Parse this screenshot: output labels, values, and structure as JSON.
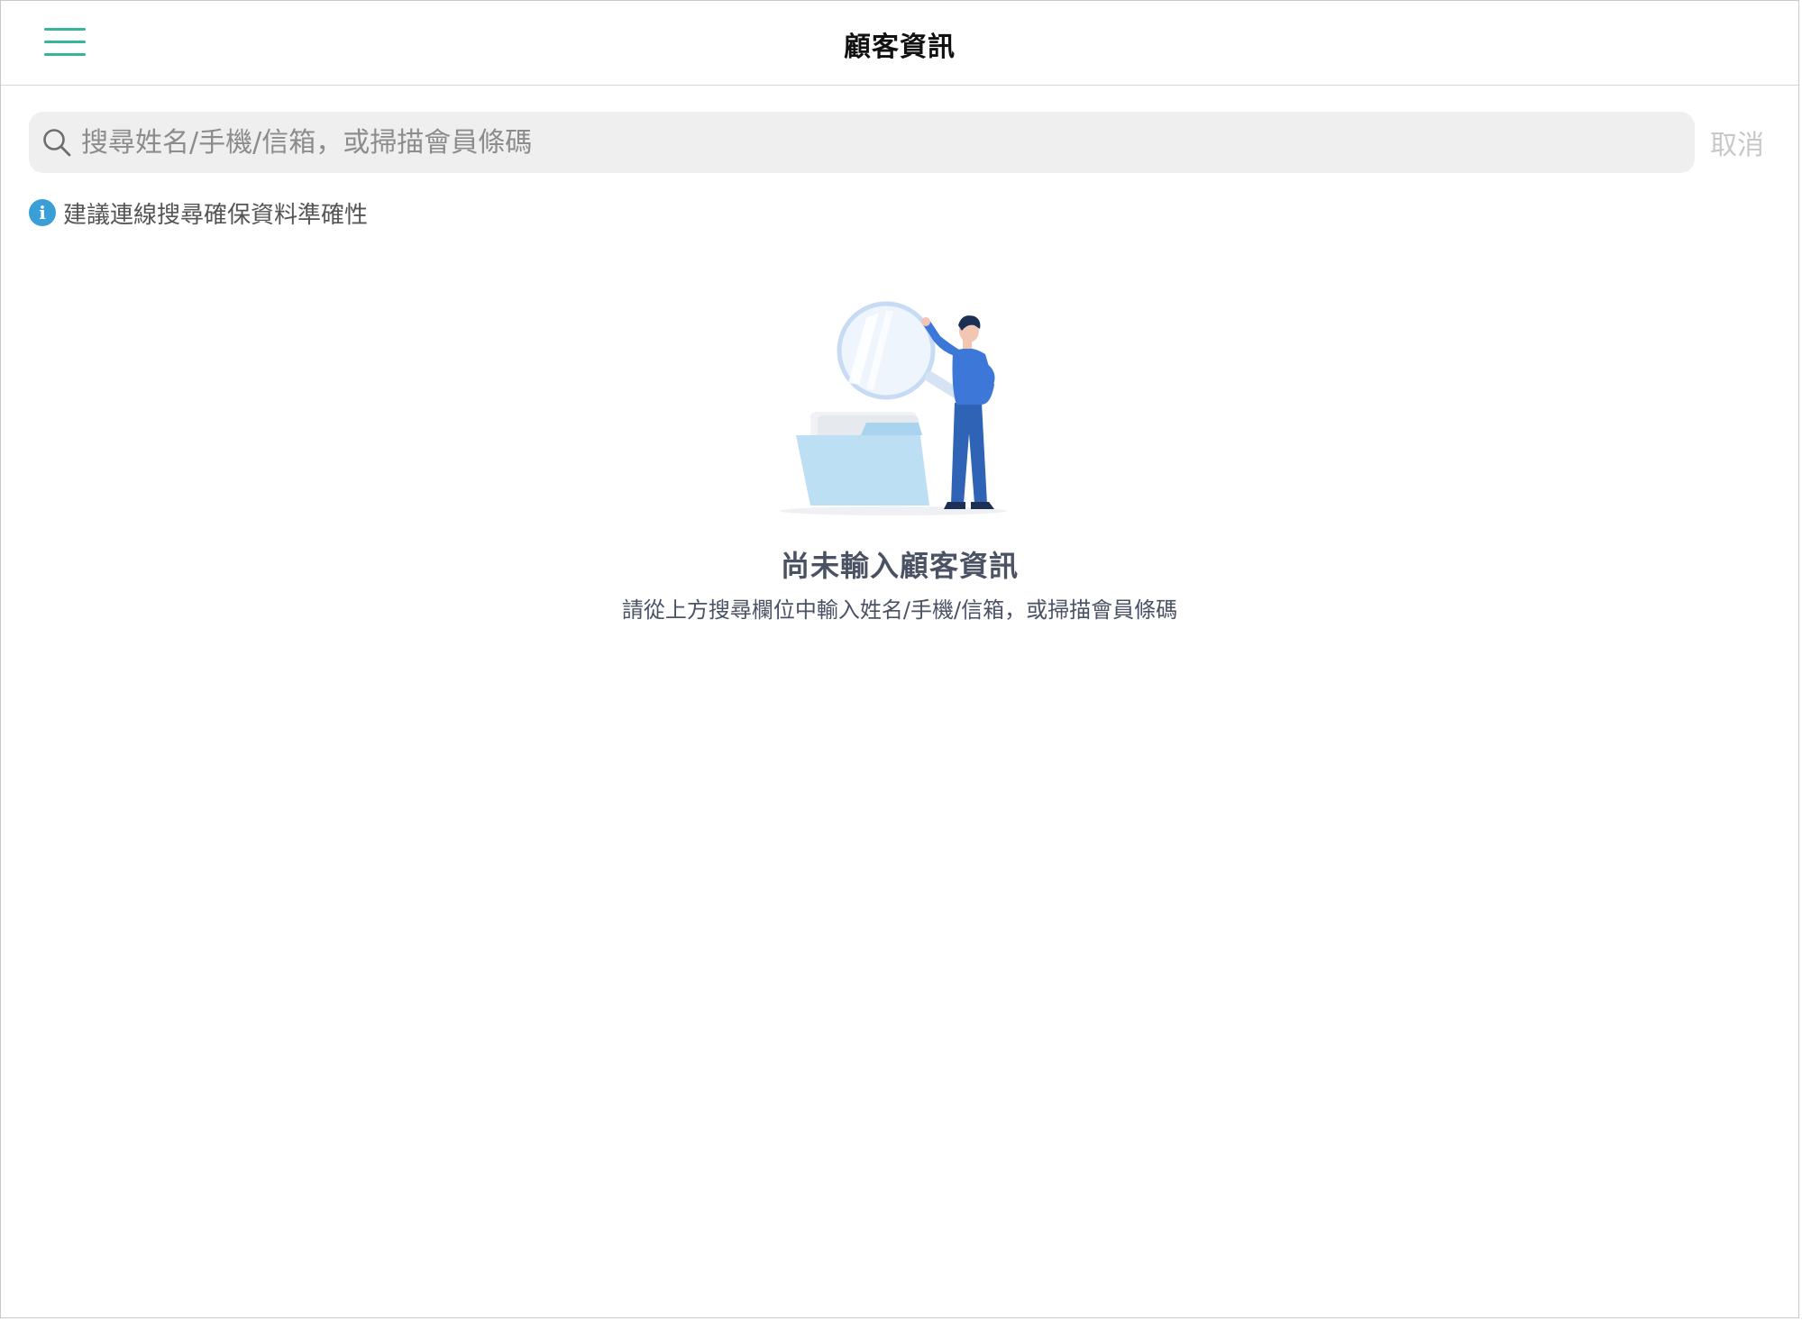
{
  "header": {
    "title": "顧客資訊",
    "menu_icon": "hamburger-menu-icon",
    "accent_color": "#37b59a"
  },
  "search": {
    "placeholder": "搜尋姓名/手機/信箱，或掃描會員條碼",
    "value": "",
    "icon": "search-icon",
    "cancel_label": "取消"
  },
  "hint": {
    "icon": "info-icon",
    "text": "建議連線搜尋確保資料準確性",
    "icon_color": "#3a9fd6"
  },
  "empty_state": {
    "illustration": "person-with-magnifier-and-folder-illustration",
    "title": "尚未輸入顧客資訊",
    "description": "請從上方搜尋欄位中輸入姓名/手機/信箱，或掃描會員條碼"
  }
}
